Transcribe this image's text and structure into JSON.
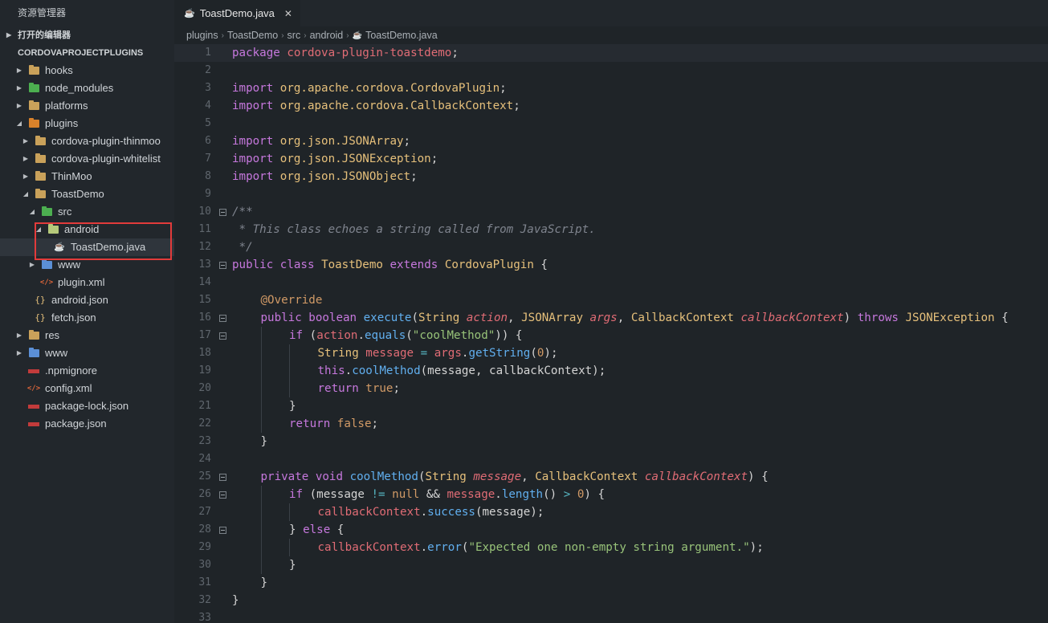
{
  "sidebar": {
    "title": "资源管理器",
    "open_editors": "打开的编辑器",
    "project": "CORDOVAPROJECTPLUGINS",
    "items": [
      {
        "label": "hooks"
      },
      {
        "label": "node_modules"
      },
      {
        "label": "platforms"
      },
      {
        "label": "plugins"
      },
      {
        "label": "cordova-plugin-thinmoo"
      },
      {
        "label": "cordova-plugin-whitelist"
      },
      {
        "label": "ThinMoo"
      },
      {
        "label": "ToastDemo"
      },
      {
        "label": "src"
      },
      {
        "label": "android"
      },
      {
        "label": "ToastDemo.java"
      },
      {
        "label": "www"
      },
      {
        "label": "plugin.xml"
      },
      {
        "label": "android.json"
      },
      {
        "label": "fetch.json"
      },
      {
        "label": "res"
      },
      {
        "label": "www"
      },
      {
        "label": ".npmignore"
      },
      {
        "label": "config.xml"
      },
      {
        "label": "package-lock.json"
      },
      {
        "label": "package.json"
      }
    ]
  },
  "tab": {
    "label": "ToastDemo.java",
    "close": "✕"
  },
  "breadcrumb": [
    "plugins",
    "ToastDemo",
    "src",
    "android",
    "ToastDemo.java"
  ],
  "code": {
    "line_numbers": [
      "1",
      "2",
      "3",
      "4",
      "5",
      "6",
      "7",
      "8",
      "9",
      "10",
      "11",
      "12",
      "13",
      "14",
      "15",
      "16",
      "17",
      "18",
      "19",
      "20",
      "21",
      "22",
      "23",
      "24",
      "25",
      "26",
      "27",
      "28",
      "29",
      "30",
      "31",
      "32",
      "33"
    ],
    "l1": [
      "package",
      "cordova-plugin-toastdemo",
      ";"
    ],
    "l3": [
      "import",
      "org.apache.cordova.",
      "CordovaPlugin",
      ";"
    ],
    "l4": [
      "import",
      "org.apache.cordova.",
      "CallbackContext",
      ";"
    ],
    "l6": [
      "import",
      "org.json.",
      "JSONArray",
      ";"
    ],
    "l7": [
      "import",
      "org.json.",
      "JSONException",
      ";"
    ],
    "l8": [
      "import",
      "org.json.",
      "JSONObject",
      ";"
    ],
    "l10": "/**",
    "l11": " * This class echoes a string called from JavaScript.",
    "l12": " */",
    "l13": [
      "public",
      "class",
      "ToastDemo",
      "extends",
      "CordovaPlugin",
      " {"
    ],
    "l15": "@Override",
    "l16": [
      "public",
      "boolean",
      "execute",
      "(",
      "String",
      "action",
      ", ",
      "JSONArray",
      "args",
      ", ",
      "CallbackContext",
      "callbackContext",
      ") ",
      "throws",
      "JSONException",
      " {"
    ],
    "l17": [
      "if",
      " (",
      "action",
      ".",
      "equals",
      "(",
      "\"coolMethod\"",
      ")) {"
    ],
    "l18": [
      "String",
      "message",
      " = ",
      "args",
      ".",
      "getString",
      "(",
      "0",
      ");"
    ],
    "l19": [
      "this",
      ".",
      "coolMethod",
      "(message, callbackContext);"
    ],
    "l20": [
      "return",
      "true",
      ";"
    ],
    "l21": "}",
    "l22": [
      "return",
      "false",
      ";"
    ],
    "l23": "}",
    "l25": [
      "private",
      "void",
      "coolMethod",
      "(",
      "String",
      "message",
      ", ",
      "CallbackContext",
      "callbackContext",
      ") {"
    ],
    "l26": [
      "if",
      " (message ",
      "!=",
      "null",
      " && ",
      "message",
      ".",
      "length",
      "() ",
      ">",
      " ",
      "0",
      ") {"
    ],
    "l27": [
      "callbackContext",
      ".",
      "success",
      "(message);"
    ],
    "l28": [
      "} ",
      "else",
      " {"
    ],
    "l29": [
      "callbackContext",
      ".",
      "error",
      "(",
      "\"Expected one non-empty string argument.\"",
      ");"
    ],
    "l30": "}",
    "l31": "}",
    "l32": "}"
  },
  "colors": {
    "accent_highlight": "#e23b3b",
    "background": "#1f2428",
    "sidebar": "#22272c"
  }
}
